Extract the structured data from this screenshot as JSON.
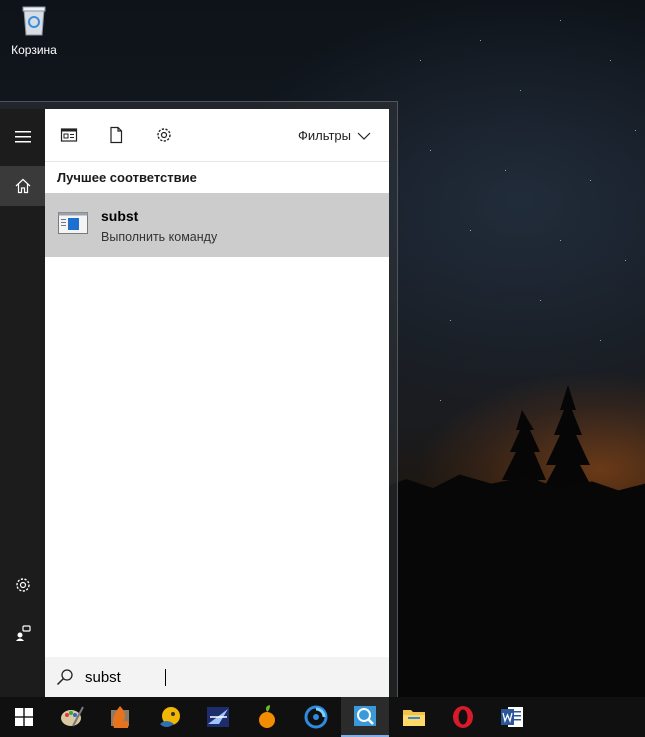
{
  "desktop": {
    "recycle_bin_label": "Корзина"
  },
  "toolbar": {
    "filters_label": "Фильтры"
  },
  "section": {
    "best_match_title": "Лучшее соответствие"
  },
  "result": {
    "name": "subst",
    "description": "Выполнить команду"
  },
  "search": {
    "value": "subst"
  },
  "taskbar": {
    "apps": [
      "start",
      "paint",
      "app-2",
      "app-3",
      "app-4",
      "fl-studio",
      "app-6",
      "search-app",
      "file-explorer",
      "opera",
      "word"
    ]
  },
  "colors": {
    "accent": "#7fb0ea",
    "rail": "#1c1c1c",
    "result_bg": "#cccccc",
    "opera_red": "#d81a2a",
    "word_blue": "#2b579a"
  }
}
